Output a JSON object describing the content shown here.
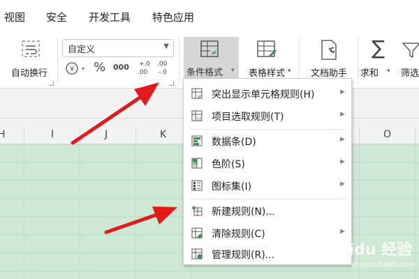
{
  "menubar": {
    "items": [
      "视图",
      "安全",
      "开发工具",
      "特色应用"
    ]
  },
  "ribbon": {
    "wrap_text": "自动换行",
    "number_format": "自定义",
    "num_icons": [
      "¥·",
      "%",
      "000",
      "+.0\n.00",
      ".00\n-.0"
    ],
    "conditional_format": "条件格式",
    "table_style": "表格样式",
    "doc_helper": "文档助手",
    "sum": "求和",
    "filter": "筛选"
  },
  "columns": [
    "H",
    "I",
    "J",
    "K",
    "O"
  ],
  "dropdown": {
    "items": [
      {
        "label": "突出显示单元格规则(H)",
        "submenu": true,
        "icon": "highlight-rules-icon"
      },
      {
        "label": "项目选取规则(T)",
        "submenu": true,
        "icon": "top-bottom-rules-icon"
      },
      {
        "label": "数据条(D)",
        "submenu": true,
        "icon": "data-bars-icon"
      },
      {
        "label": "色阶(S)",
        "submenu": true,
        "icon": "color-scales-icon"
      },
      {
        "label": "图标集(I)",
        "submenu": true,
        "icon": "icon-sets-icon"
      },
      {
        "label": "新建规则(N)...",
        "submenu": false,
        "icon": "new-rule-icon"
      },
      {
        "label": "清除规则(C)",
        "submenu": true,
        "icon": "clear-rules-icon"
      },
      {
        "label": "管理规则(R)...",
        "submenu": false,
        "icon": "manage-rules-icon"
      }
    ]
  },
  "watermark": {
    "text": "Baidu 经验",
    "sub": "jingyan.baidu.com"
  },
  "colors": {
    "grid": "#cde9d4",
    "arrow": "#e3191b",
    "button_active": "#d5d5d5"
  }
}
